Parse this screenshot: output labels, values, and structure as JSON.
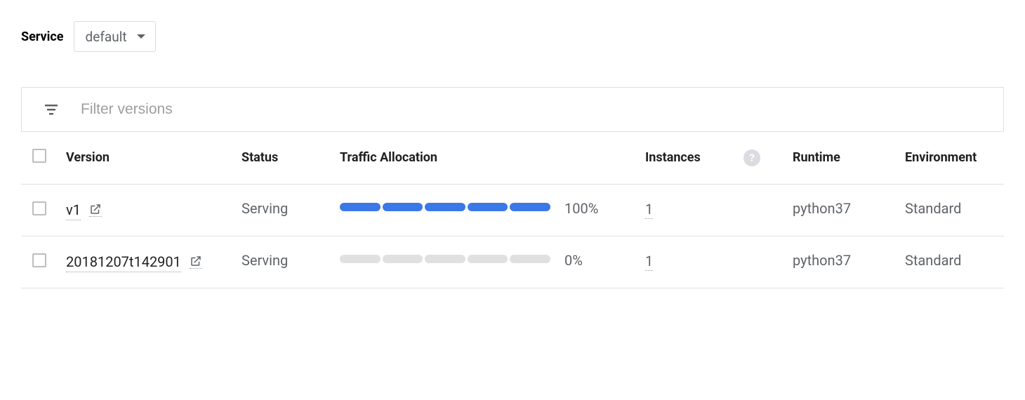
{
  "service": {
    "label": "Service",
    "selected": "default"
  },
  "filter": {
    "placeholder": "Filter versions"
  },
  "columns": {
    "version": "Version",
    "status": "Status",
    "traffic": "Traffic Allocation",
    "instances": "Instances",
    "runtime": "Runtime",
    "environment": "Environment"
  },
  "help": "?",
  "rows": [
    {
      "version": "v1",
      "status": "Serving",
      "traffic_percent": "100%",
      "traffic_fill": 5,
      "instances": "1",
      "runtime": "python37",
      "environment": "Standard"
    },
    {
      "version": "20181207t142901",
      "status": "Serving",
      "traffic_percent": "0%",
      "traffic_fill": 0,
      "instances": "1",
      "runtime": "python37",
      "environment": "Standard"
    }
  ]
}
